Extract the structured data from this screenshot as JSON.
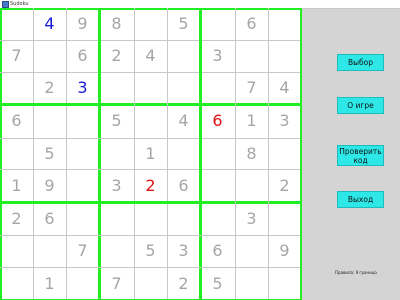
{
  "window": {
    "title": "Sudoku"
  },
  "board": {
    "grid": [
      [
        "",
        "4",
        "9",
        "8",
        "",
        "5",
        "",
        "6",
        ""
      ],
      [
        "7",
        "",
        "6",
        "2",
        "4",
        "",
        "3",
        "",
        ""
      ],
      [
        "",
        "2",
        "3",
        "",
        "",
        "",
        "",
        "7",
        "4"
      ],
      [
        "6",
        "",
        "",
        "5",
        "",
        "4",
        "6",
        "1",
        "3"
      ],
      [
        "",
        "5",
        "",
        "",
        "1",
        "",
        "",
        "8",
        ""
      ],
      [
        "1",
        "9",
        "",
        "3",
        "2",
        "6",
        "",
        "",
        "2"
      ],
      [
        "2",
        "6",
        "",
        "",
        "",
        "",
        "",
        "3",
        ""
      ],
      [
        "",
        "",
        "7",
        "",
        "5",
        "3",
        "6",
        "",
        "9"
      ],
      [
        "",
        "1",
        "",
        "7",
        "",
        "2",
        "5",
        "",
        ""
      ]
    ],
    "user_entries": [
      [
        0,
        1
      ],
      [
        2,
        2
      ]
    ],
    "conflicts": [
      [
        3,
        6
      ],
      [
        5,
        4
      ]
    ]
  },
  "buttons": {
    "select": "Выбор",
    "about": "О игре",
    "check": "Проверить\nкод",
    "exit": "Выход"
  },
  "status": "Правила: 9 граница",
  "colors": {
    "thick_line": "#22ee22",
    "thin_line": "#c8c8c8",
    "given": "#a6a6a6",
    "user": "#1a1ad8",
    "conflict": "#e01414",
    "panel_bg": "#d4d4d4",
    "button_bg": "#2ee8e8"
  }
}
